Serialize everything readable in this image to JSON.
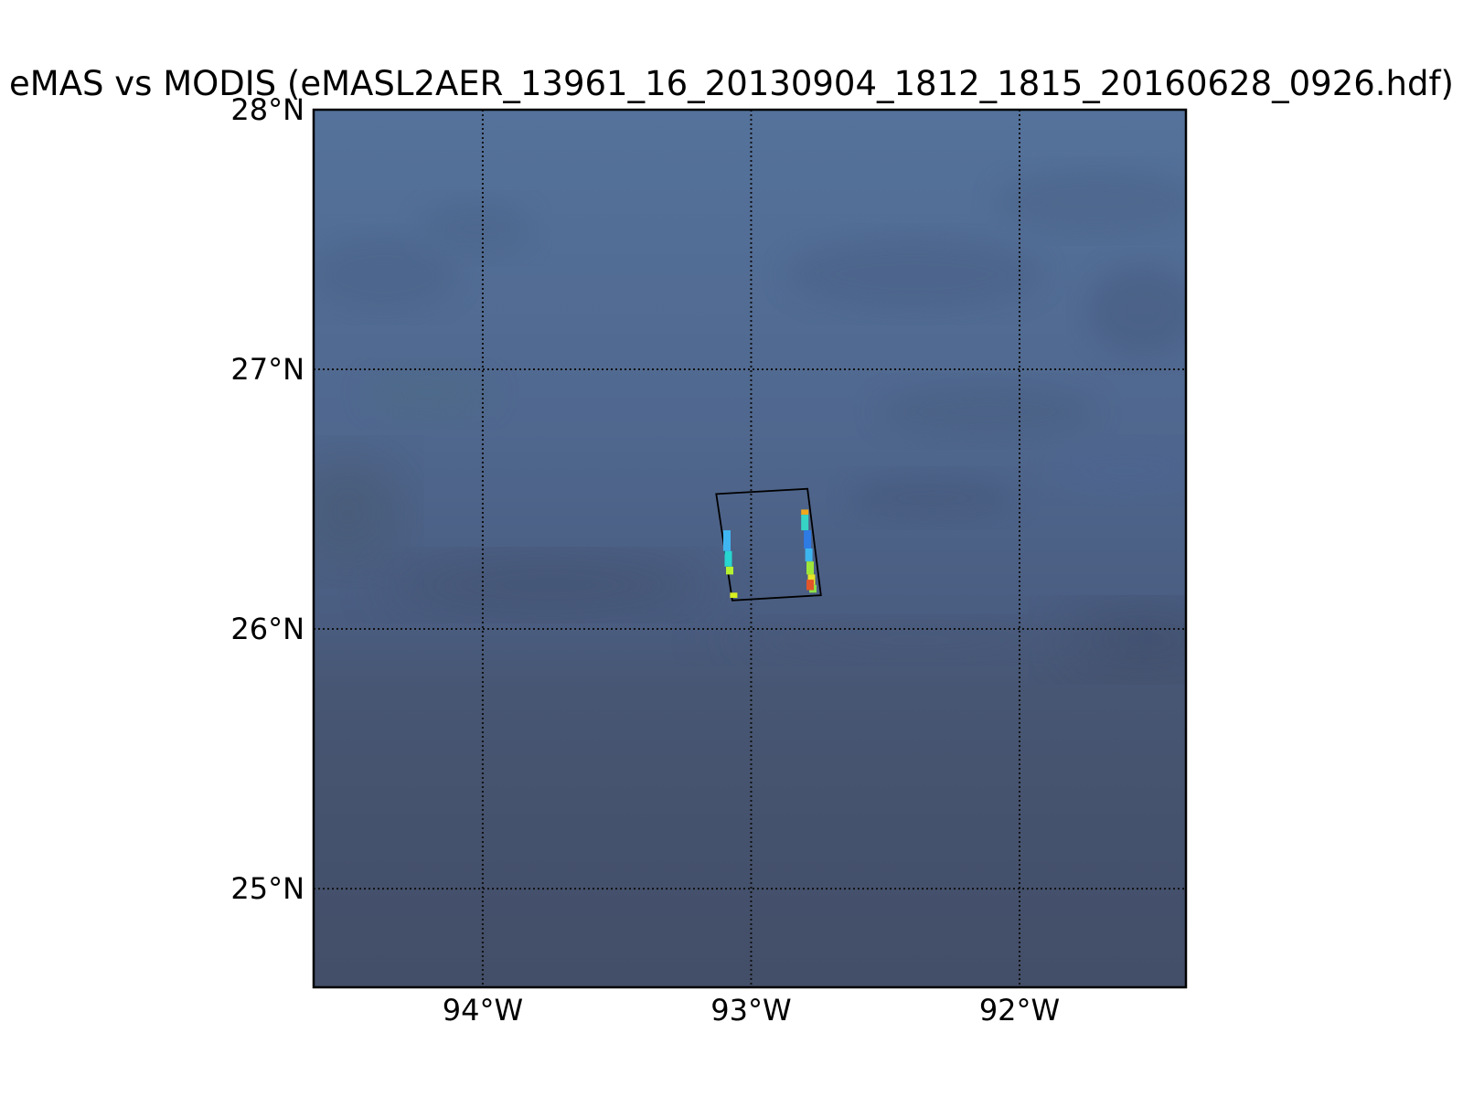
{
  "title": "eMAS vs MODIS (eMASL2AER_13961_16_20130904_1812_1815_20160628_0926.hdf)",
  "map": {
    "type": "map",
    "projection": "equirectangular",
    "extent": {
      "lon_min": -94.63,
      "lon_max": -91.38,
      "lat_min": 24.62,
      "lat_max": 28.0
    },
    "background": "satellite-imagery-ocean",
    "colors": {
      "ocean_top": "#54729b",
      "ocean_mid": "#4d6287",
      "ocean_bottom": "#445068",
      "cloud_shadow": "#3e4d66",
      "frame": "#000000",
      "gridline": "#111111"
    },
    "grid": true,
    "gridline_style": "dotted",
    "latitude_ticks": [
      {
        "value": 28,
        "label": "28°N"
      },
      {
        "value": 27,
        "label": "27°N"
      },
      {
        "value": 26,
        "label": "26°N"
      },
      {
        "value": 25,
        "label": "25°N"
      }
    ],
    "longitude_ticks": [
      {
        "value": -94,
        "label": "94°W"
      },
      {
        "value": -93,
        "label": "93°W"
      },
      {
        "value": -92,
        "label": "92°W"
      }
    ],
    "footprint": {
      "name": "eMAS granule footprint",
      "corners": [
        {
          "lon": -93.13,
          "lat": 26.52
        },
        {
          "lon": -92.79,
          "lat": 26.54
        },
        {
          "lon": -92.74,
          "lat": 26.13
        },
        {
          "lon": -93.07,
          "lat": 26.11
        }
      ]
    },
    "retrieval_swaths": [
      {
        "segments": [
          {
            "lon": -93.09,
            "lat_start": 26.38,
            "lat_end": 26.3,
            "color": "#3fb6f2"
          },
          {
            "lon": -93.085,
            "lat_start": 26.3,
            "lat_end": 26.24,
            "color": "#27d6d0"
          },
          {
            "lon": -93.08,
            "lat_start": 26.24,
            "lat_end": 26.21,
            "color": "#b7f22f"
          },
          {
            "lon": -93.065,
            "lat_start": 26.14,
            "lat_end": 26.12,
            "color": "#d8ef20"
          }
        ]
      },
      {
        "segments": [
          {
            "lon": -92.8,
            "lat_start": 26.46,
            "lat_end": 26.44,
            "color": "#f0a71c"
          },
          {
            "lon": -92.8,
            "lat_start": 26.44,
            "lat_end": 26.38,
            "color": "#36d4c4"
          },
          {
            "lon": -92.79,
            "lat_start": 26.38,
            "lat_end": 26.31,
            "color": "#2f7be4"
          },
          {
            "lon": -92.785,
            "lat_start": 26.31,
            "lat_end": 26.26,
            "color": "#3db6ef"
          },
          {
            "lon": -92.78,
            "lat_start": 26.26,
            "lat_end": 26.21,
            "color": "#9ee63a"
          },
          {
            "lon": -92.775,
            "lat_start": 26.21,
            "lat_end": 26.17,
            "color": "#e9e326"
          },
          {
            "lon": -92.77,
            "lat_start": 26.17,
            "lat_end": 26.14,
            "color": "#8ee048"
          },
          {
            "lon": -92.78,
            "lat_start": 26.19,
            "lat_end": 26.15,
            "color": "#e0562a"
          }
        ]
      }
    ]
  }
}
